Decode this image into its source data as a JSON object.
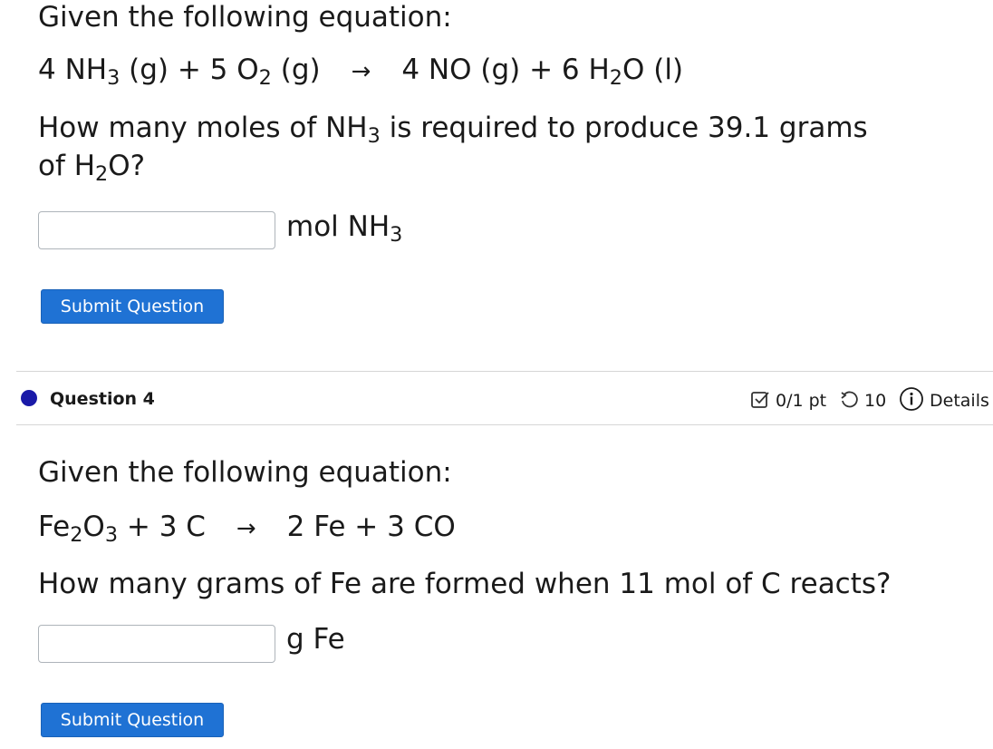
{
  "question3": {
    "intro": "Given the following equation:",
    "equation": {
      "r1_coef": "4 NH",
      "r1_sub": "3",
      "r1_state": " (g) + 5 O",
      "r2_sub": "2",
      "r2_state": " (g)",
      "arrow": "→",
      "p1": "4 NO  (g) + 6 H",
      "p2_sub": "2",
      "p2_rest": "O (l)"
    },
    "prompt": {
      "part1": "How many moles of NH",
      "sub1": "3",
      "part2": " is required to produce 39.1 grams",
      "part3": "of H",
      "sub2": "2",
      "part4": "O?"
    },
    "answer": {
      "value": "",
      "unit_pre": "mol NH",
      "unit_sub": "3"
    },
    "submit_label": "Submit Question"
  },
  "question4_header": {
    "title": "Question 4",
    "score": "0/1 pt",
    "attempts": "10",
    "details_label": "Details",
    "dot_color": "#1a1aa8"
  },
  "question4": {
    "intro": "Given the following equation:",
    "equation": {
      "r1a": "Fe",
      "r1_sub1": "2",
      "r1b": "O",
      "r1_sub2": "3",
      "r1_rest": " + 3 C",
      "arrow": "→",
      "products": "2 Fe  + 3 CO"
    },
    "prompt": "How many grams of Fe are formed when 11 mol of C reacts?",
    "answer": {
      "value": "",
      "unit": "g Fe"
    },
    "submit_label": "Submit Question"
  }
}
